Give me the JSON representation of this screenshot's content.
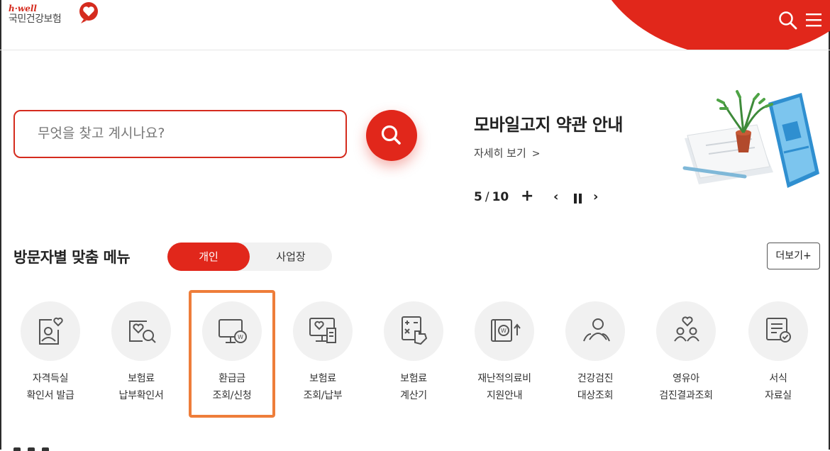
{
  "header": {
    "logo_en": "h·well",
    "logo_ko": "국민건강보험",
    "search_icon": "search-icon",
    "menu_icon": "hamburger-menu-icon",
    "accent_color": "#e1271b"
  },
  "search": {
    "placeholder": "무엇을 찾고 계시나요?",
    "button_icon": "search-icon"
  },
  "banner": {
    "title": "모바일고지 약관 안내",
    "link_label": "자세히 보기",
    "link_chevron": ">",
    "pager_current": "5",
    "pager_sep": "/",
    "pager_total": "10",
    "plus_label": "+",
    "prev_label": "‹",
    "next_label": "›"
  },
  "menu_section": {
    "title": "방문자별 맞춤 메뉴",
    "toggle_active": "개인",
    "toggle_inactive": "사업장",
    "more_label": "더보기+",
    "items": [
      {
        "line1": "자격득실",
        "line2": "확인서 발급",
        "icon": "person-heart-card-icon"
      },
      {
        "line1": "보험료",
        "line2": "납부확인서",
        "icon": "heart-doc-search-icon"
      },
      {
        "line1": "환급금",
        "line2": "조회/신청",
        "icon": "monitor-won-coin-icon",
        "highlighted": true
      },
      {
        "line1": "보험료",
        "line2": "조회/납부",
        "icon": "monitor-heart-receipt-icon"
      },
      {
        "line1": "보험료",
        "line2": "계산기",
        "icon": "calculator-hand-icon"
      },
      {
        "line1": "재난적의료비",
        "line2": "지원안내",
        "icon": "won-wallet-up-icon"
      },
      {
        "line1": "건강검진",
        "line2": "대상조회",
        "icon": "people-group-icon"
      },
      {
        "line1": "영유아",
        "line2": "검진결과조회",
        "icon": "family-heart-icon"
      },
      {
        "line1": "서식",
        "line2": "자료실",
        "icon": "document-check-icon"
      }
    ]
  }
}
